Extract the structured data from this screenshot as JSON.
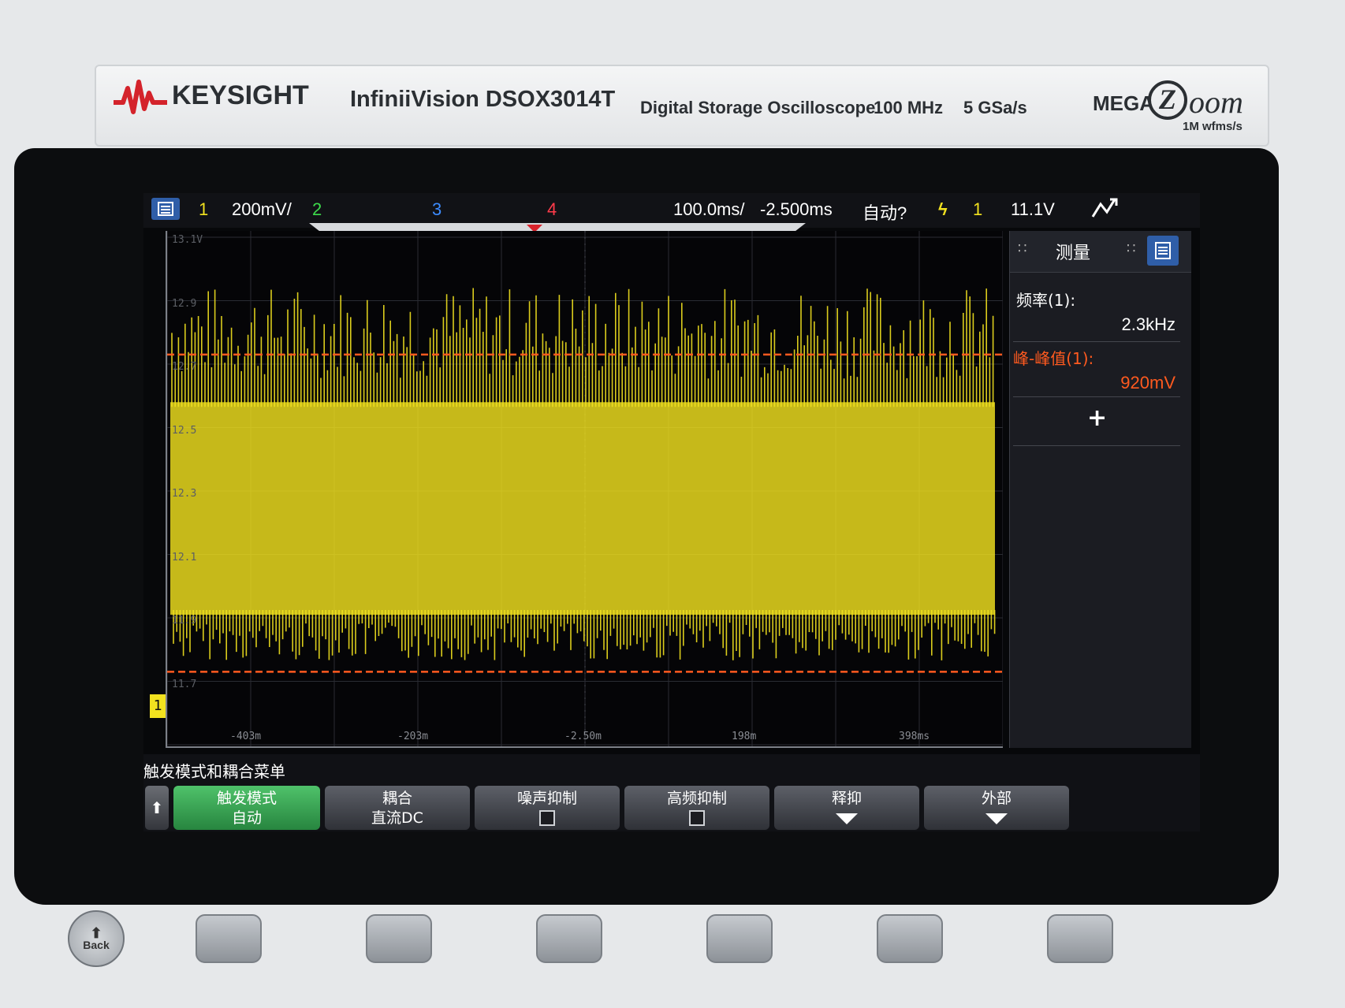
{
  "header": {
    "brand": "KEYSIGHT",
    "model": "InfiniiVision DSOX3014T",
    "description": "Digital Storage Oscilloscope",
    "bandwidth": "100 MHz",
    "sample_rate": "5 GSa/s",
    "megazoom": "MEGA",
    "megazoom_suffix": "oom",
    "wfms": "1M wfms/s"
  },
  "topbar": {
    "ch1": "1",
    "ch1_scale": "200mV/",
    "ch2": "2",
    "ch3": "3",
    "ch4": "4",
    "timebase": "100.0ms/",
    "delay": "-2.500ms",
    "trigger_mode": "自动?",
    "trigger_channel": "1",
    "trigger_level": "11.1V"
  },
  "colors": {
    "ch1": "#f2e21f",
    "ch2": "#3ddc4b",
    "ch3": "#3d8cff",
    "ch4": "#ff3b4a",
    "cursor": "#ff5a1f",
    "softkey_active": "#3cb55a"
  },
  "plot": {
    "y_labels": [
      "13.1V",
      "12.9",
      "12.7",
      "12.5",
      "12.3",
      "12.1",
      "11.9",
      "11.7"
    ],
    "x_labels": [
      "-403m",
      "-203m",
      "-2.50m",
      "198m",
      "398ms"
    ],
    "marker": "1",
    "signal_bands": [
      {
        "top": 12.58,
        "bottom": 11.91
      }
    ],
    "cursor_levels": [
      12.73,
      11.73
    ]
  },
  "panel": {
    "title": "测量",
    "m1_label": "频率(1):",
    "m1_value": "2.3kHz",
    "m2_label": "峰-峰值(1):",
    "m2_value": "920mV",
    "add": "+"
  },
  "softbar": {
    "title": "触发模式和耦合菜单",
    "keys": [
      {
        "label": "触发模式",
        "value": "自动"
      },
      {
        "label": "耦合",
        "value": "直流DC"
      },
      {
        "label": "噪声抑制",
        "value": ""
      },
      {
        "label": "高频抑制",
        "value": ""
      },
      {
        "label": "释抑",
        "value": ""
      },
      {
        "label": "外部",
        "value": ""
      }
    ]
  },
  "hardware": {
    "back": "Back"
  }
}
